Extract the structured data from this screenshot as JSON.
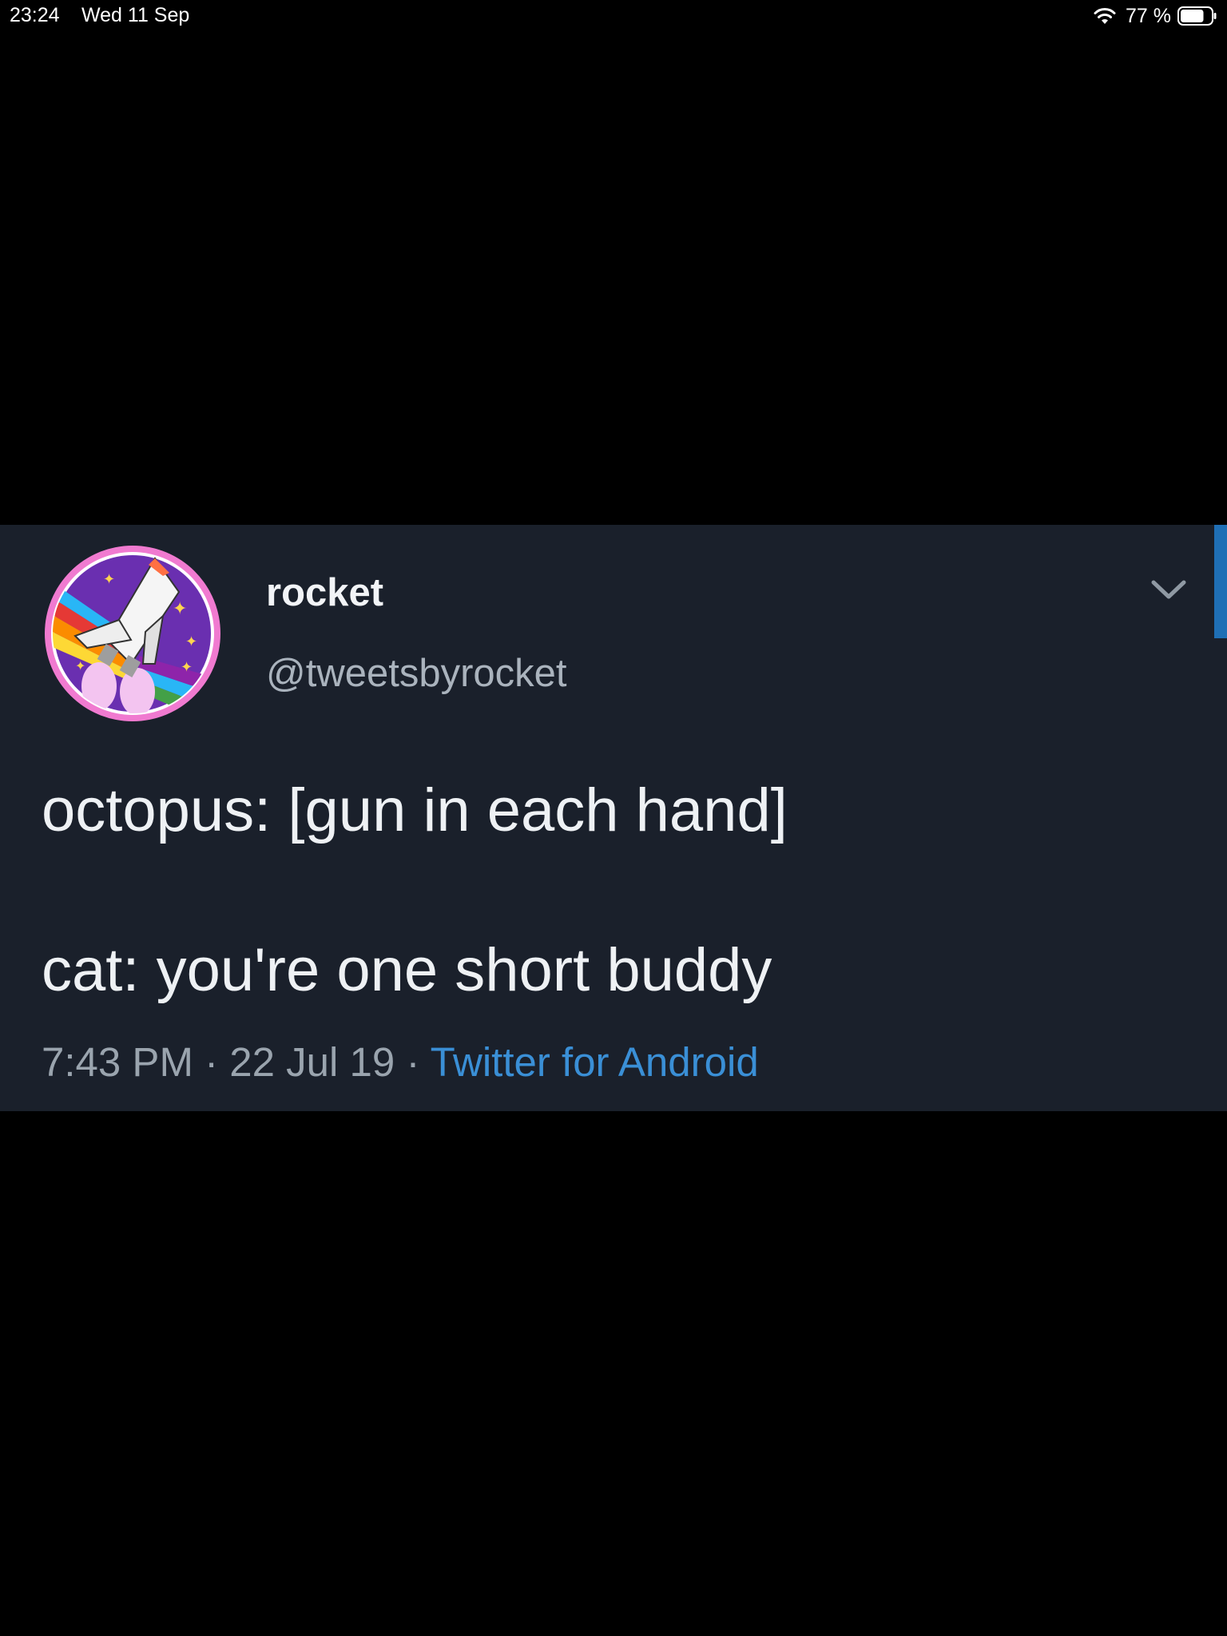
{
  "status_bar": {
    "time": "23:24",
    "date": "Wed 11 Sep",
    "battery_percent": "77 %",
    "battery_level": 0.77
  },
  "tweet": {
    "display_name": "rocket",
    "handle": "@tweetsbyrocket",
    "text_lines": [
      "octopus: [gun in each hand]",
      "cat: you're one short buddy"
    ],
    "time": "7:43 PM",
    "separator": "·",
    "date": "22 Jul 19",
    "source": "Twitter for Android"
  },
  "colors": {
    "background": "#000000",
    "card": "#1a202b",
    "link": "#3a8fd6",
    "accent": "#1f6fb5"
  },
  "icons": {
    "avatar": "rocket-avatar",
    "wifi": "wifi-icon",
    "battery": "battery-icon",
    "menu": "chevron-down-icon"
  }
}
